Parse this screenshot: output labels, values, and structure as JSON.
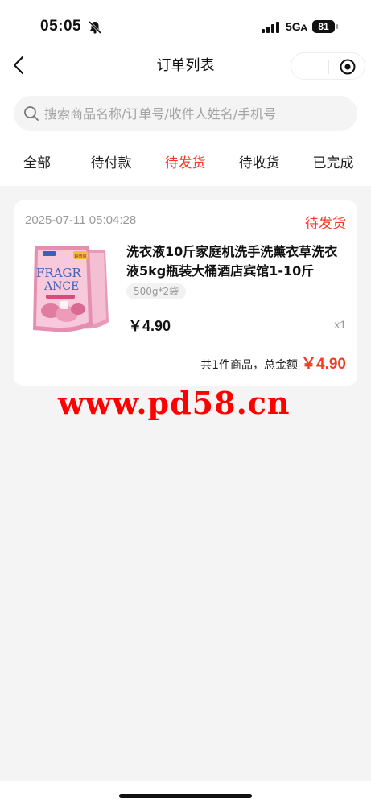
{
  "status_bar": {
    "time": "05:05",
    "network": "5Gᴀ",
    "battery": "81"
  },
  "nav": {
    "title": "订单列表"
  },
  "search": {
    "placeholder": "搜索商品名称/订单号/收件人姓名/手机号"
  },
  "tabs": [
    {
      "label": "全部",
      "active": false
    },
    {
      "label": "待付款",
      "active": false
    },
    {
      "label": "待发货",
      "active": true
    },
    {
      "label": "待收货",
      "active": false
    },
    {
      "label": "已完成",
      "active": false
    }
  ],
  "order": {
    "date": "2025-07-11 05:04:28",
    "status": "待发货",
    "product_name": "洗衣液10斤家庭机洗手洗薰衣草洗衣液5kg瓶装大桶酒店宾馆1-10斤",
    "spec": "500g*2袋",
    "price": "￥4.90",
    "quantity": "x1",
    "summary": "共1件商品，总金额",
    "total": "￥4.90",
    "thumbnail_text": {
      "line1": "FRAGR",
      "line2": "ANCE",
      "badge": "超值装"
    }
  },
  "watermark": "www.pd58.cn",
  "colors": {
    "accent": "#f23c24",
    "watermark": "#ff0000",
    "background": "#f4f4f4"
  }
}
